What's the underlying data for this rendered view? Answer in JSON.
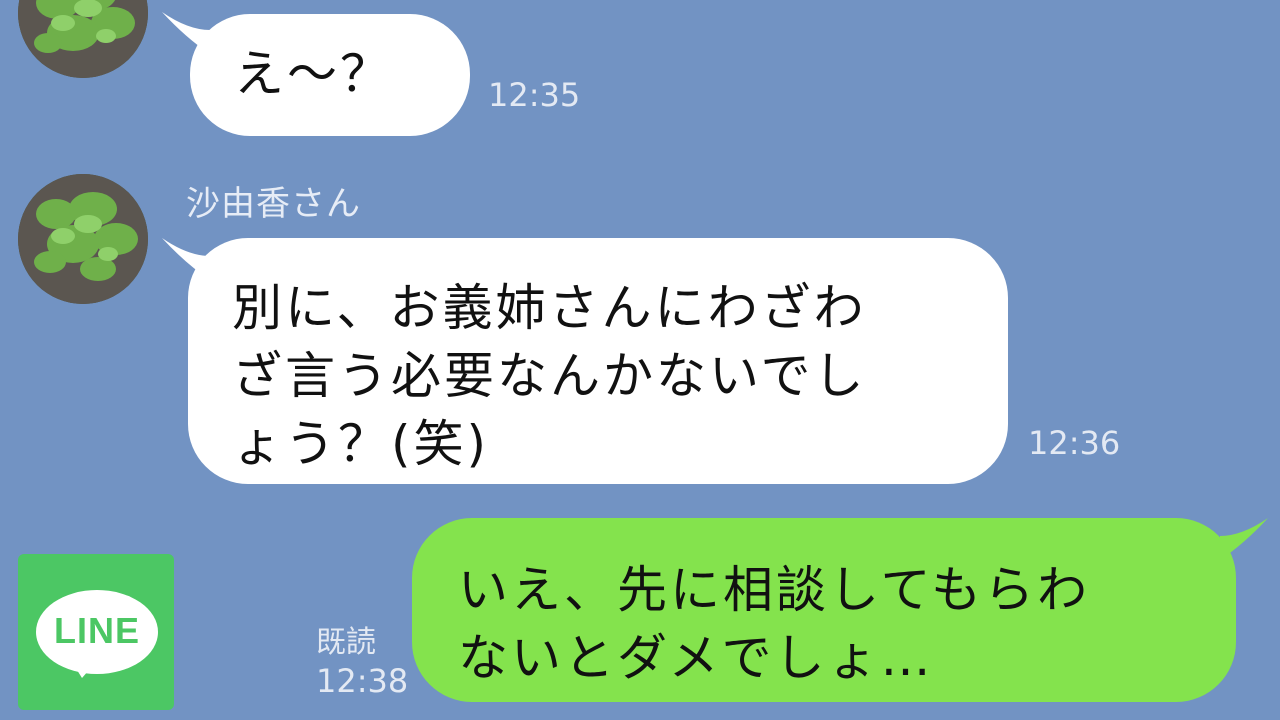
{
  "messages": [
    {
      "text": "え〜？",
      "time": "12:35"
    },
    {
      "sender": "沙由香さん",
      "lines": [
        "別に、お義姉さんにわざわ",
        "ざ言う必要なんかないでし",
        "ょう？(笑)"
      ],
      "time": "12:36"
    },
    {
      "lines": [
        "いえ、先に相談してもらわ",
        "ないとダメでしょ…"
      ],
      "read_label": "既読",
      "time": "12:38"
    }
  ],
  "logo": {
    "text": "LINE"
  },
  "colors": {
    "background": "#7293c3",
    "incoming": "#ffffff",
    "outgoing": "#84e34d",
    "logo": "#4cc764"
  }
}
